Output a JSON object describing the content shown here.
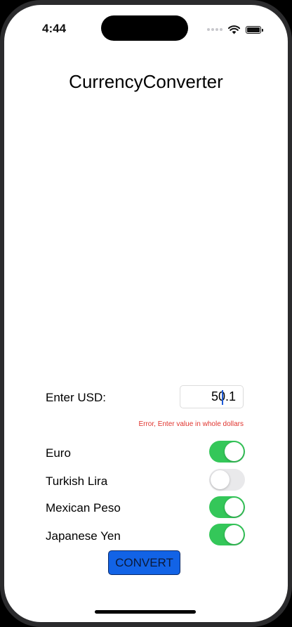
{
  "status_bar": {
    "time": "4:44"
  },
  "app": {
    "title": "CurrencyConverter"
  },
  "usd": {
    "label": "Enter USD:",
    "value": "50.1",
    "error": "Error, Enter value in whole dollars"
  },
  "currencies": [
    {
      "label": "Euro",
      "enabled": true
    },
    {
      "label": "Turkish Lira",
      "enabled": false
    },
    {
      "label": "Mexican Peso",
      "enabled": true
    },
    {
      "label": "Japanese Yen",
      "enabled": true
    }
  ],
  "convert_button": {
    "label": "CONVERT"
  },
  "colors": {
    "toggle_on": "#34c759",
    "toggle_off": "#e9e9eb",
    "button": "#1263e6",
    "error": "#e0342e"
  }
}
